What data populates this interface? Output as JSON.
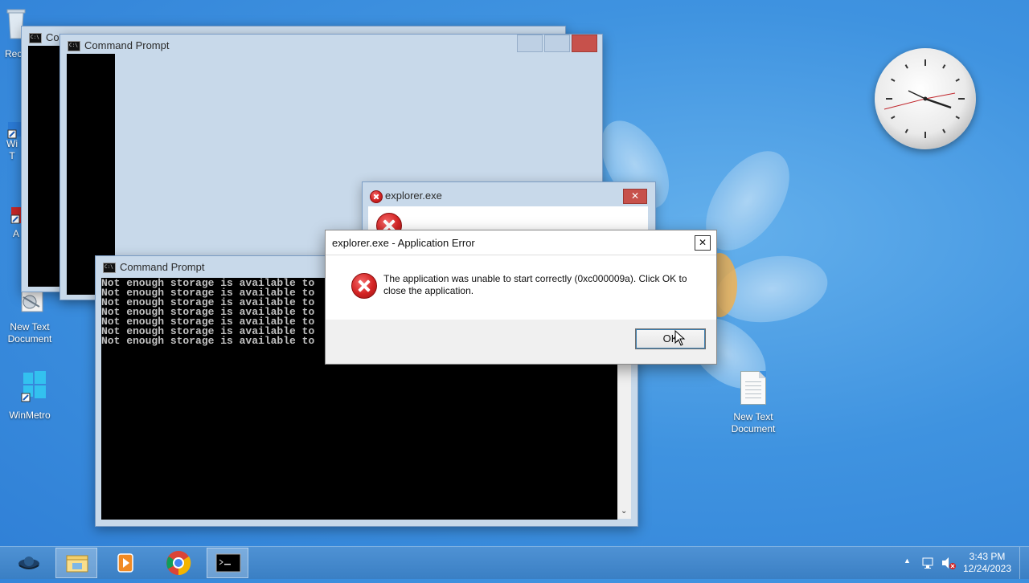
{
  "desktop": {
    "icons": [
      {
        "label": "Rec",
        "name": "recycle-bin"
      },
      {
        "label": "Wi\nT",
        "name": "windows-tools"
      },
      {
        "label": "A",
        "name": "app-shortcut"
      },
      {
        "label": "New Text\nDocument",
        "name": "new-text-document-left"
      },
      {
        "label": "WinMetro",
        "name": "winmetro"
      },
      {
        "label": "New Text\nDocument",
        "name": "new-text-document-right"
      }
    ]
  },
  "windows": {
    "back_console_1": {
      "title": "Co"
    },
    "back_console_2": {
      "title": "Command Prompt"
    },
    "front_console": {
      "title": "Command Prompt",
      "lines": [
        "Not enough storage is available to",
        "Not enough storage is available to",
        "Not enough storage is available to",
        "Not enough storage is available to",
        "Not enough storage is available to",
        "Not enough storage is available to",
        "Not enough storage is available to"
      ]
    }
  },
  "dialogs": {
    "explorer_back": {
      "title": "explorer.exe",
      "close_glyph": "✕"
    },
    "app_error": {
      "title": "explorer.exe - Application Error",
      "close_glyph": "✕",
      "message": "The application was unable to start correctly (0xc000009a). Click OK to close the application.",
      "ok_label": "OK"
    }
  },
  "taskbar": {
    "apps": [
      "start-orb",
      "file-explorer",
      "media-player",
      "chrome",
      "command-prompt"
    ],
    "time": "3:43 PM",
    "date": "12/24/2023",
    "tray_chevron": "▲"
  },
  "colors": {
    "desktop_blue": "#3f93e0",
    "title_active": "#c8d9ea",
    "close_red": "#c7514b",
    "console_bg": "#000000",
    "console_text": "#c0c0c0"
  }
}
